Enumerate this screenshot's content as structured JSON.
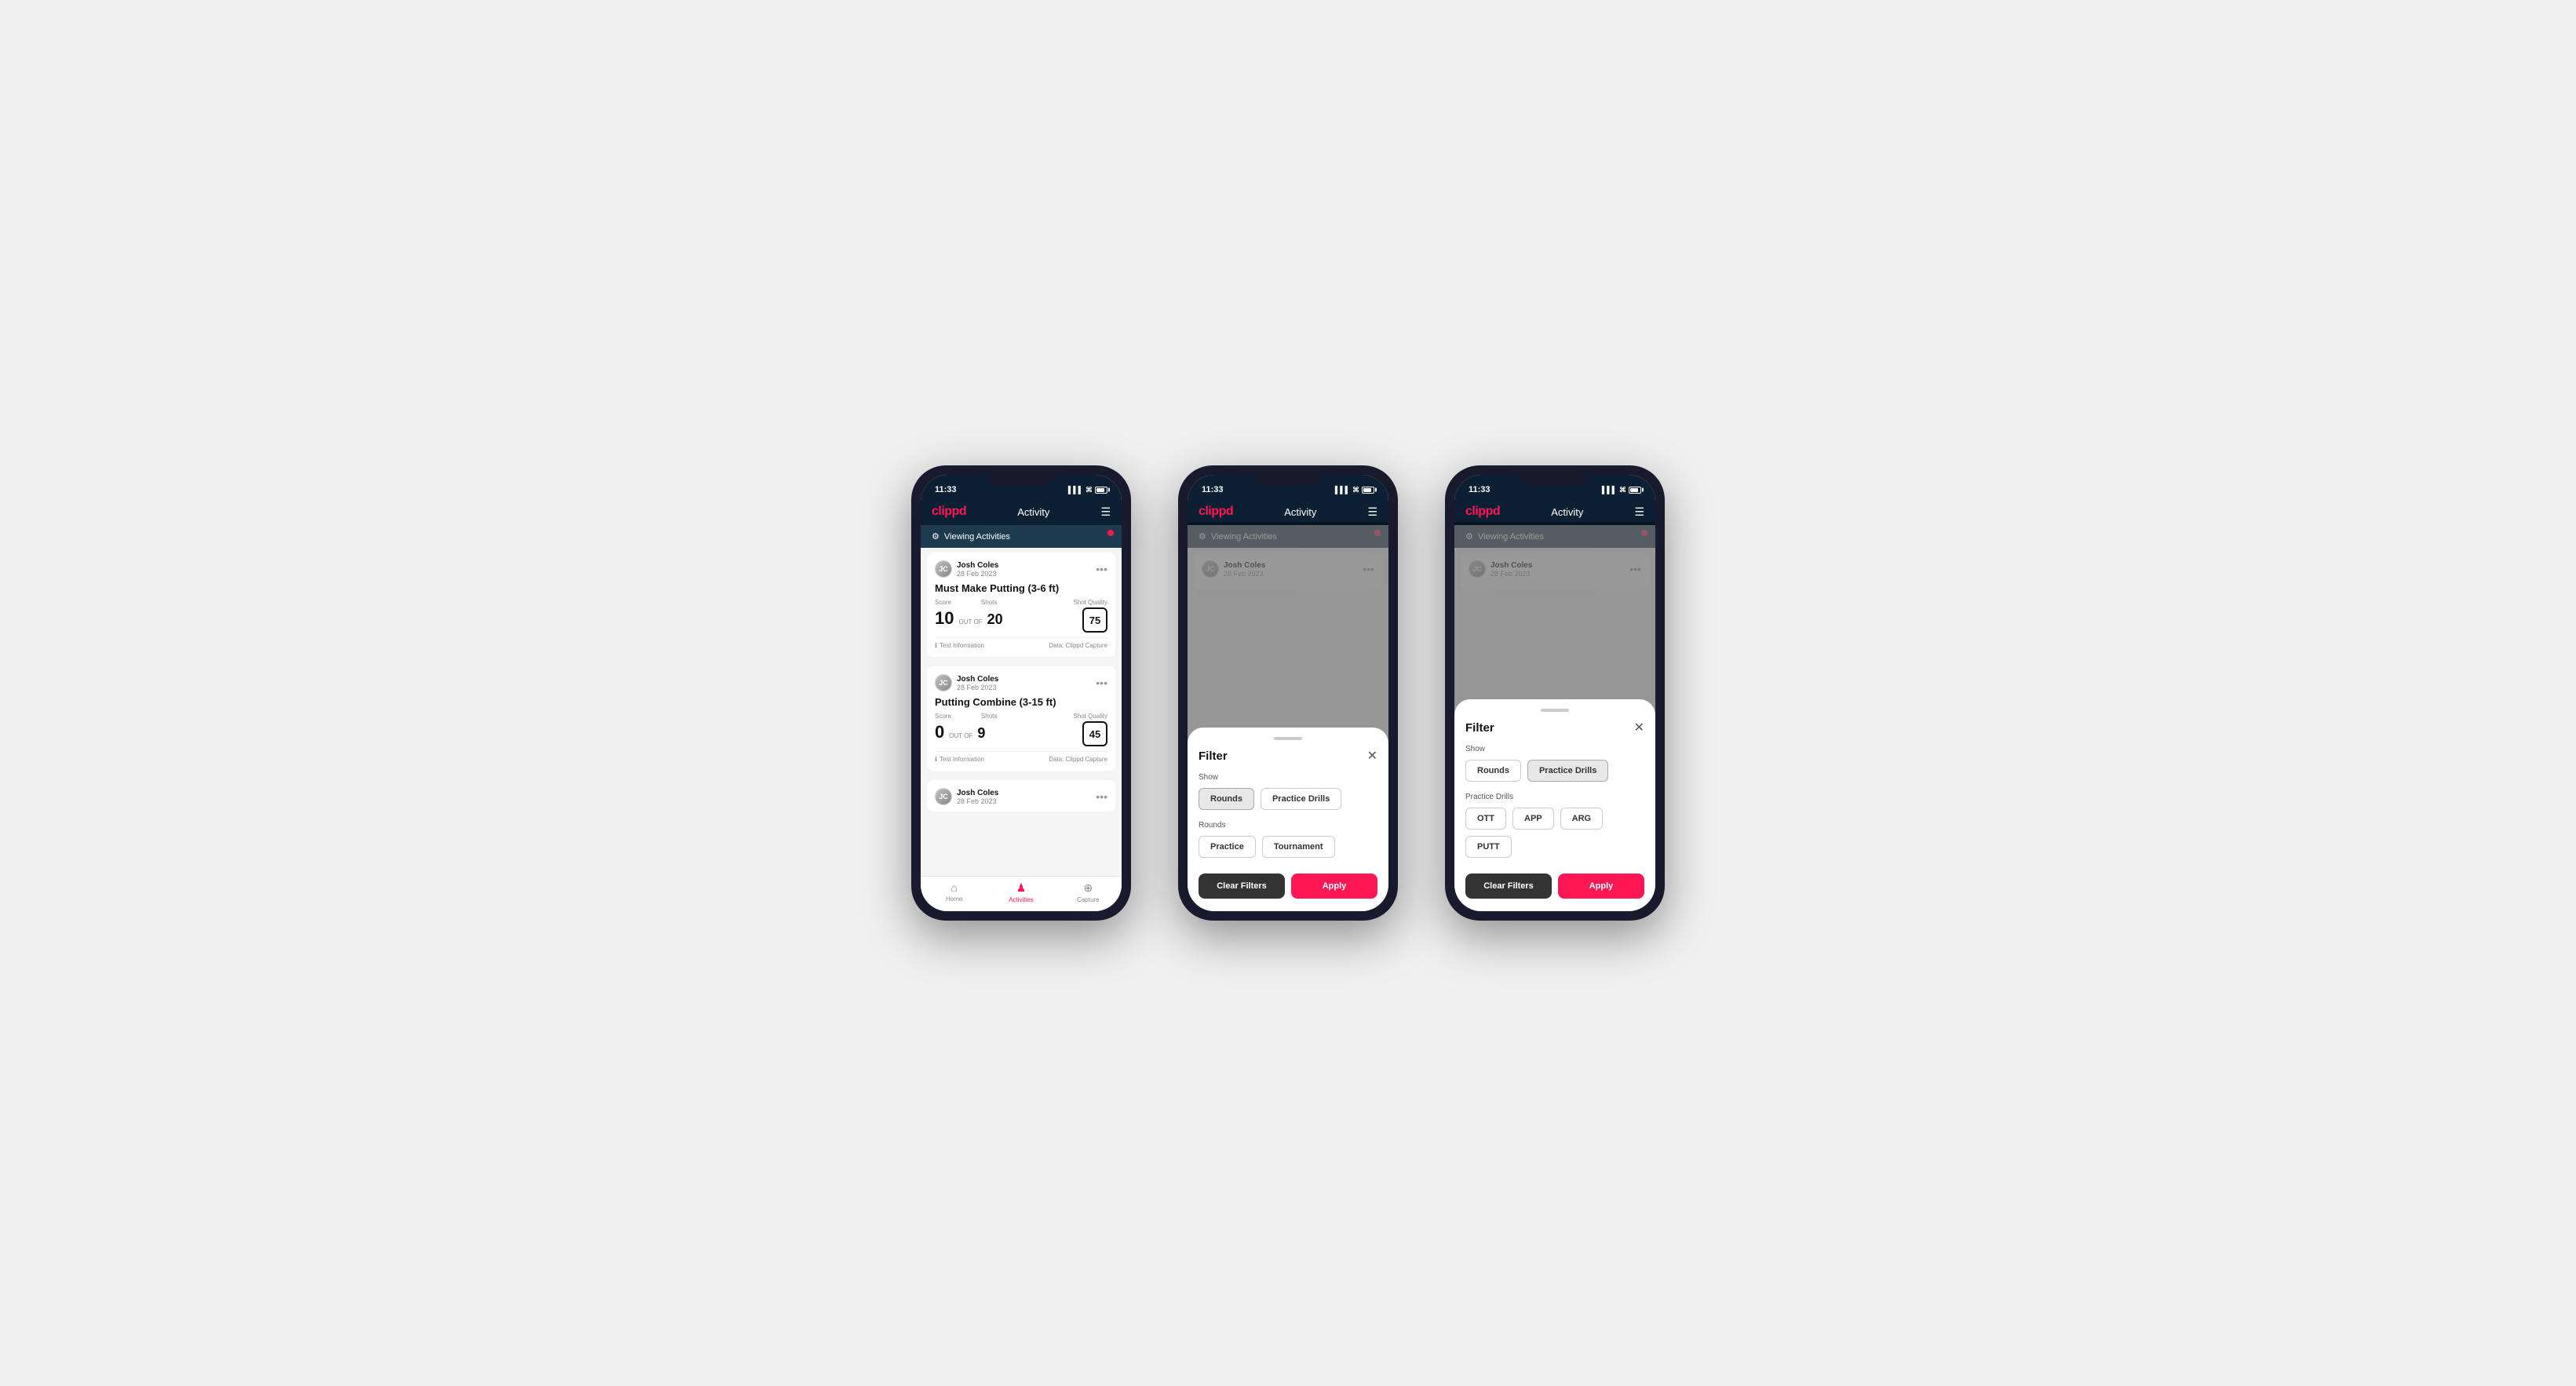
{
  "app": {
    "logo": "clippd",
    "header_title": "Activity",
    "time": "11:33",
    "viewing_bar_text": "Viewing Activities"
  },
  "screen1": {
    "activities": [
      {
        "user_name": "Josh Coles",
        "user_date": "28 Feb 2023",
        "title": "Must Make Putting (3-6 ft)",
        "score_label": "Score",
        "score_value": "10",
        "out_of_label": "OUT OF",
        "shots_label": "Shots",
        "shots_value": "20",
        "shot_quality_label": "Shot Quality",
        "shot_quality_value": "75",
        "footer_info": "Test Information",
        "footer_data": "Data: Clippd Capture"
      },
      {
        "user_name": "Josh Coles",
        "user_date": "28 Feb 2023",
        "title": "Putting Combine (3-15 ft)",
        "score_label": "Score",
        "score_value": "0",
        "out_of_label": "OUT OF",
        "shots_label": "Shots",
        "shots_value": "9",
        "shot_quality_label": "Shot Quality",
        "shot_quality_value": "45",
        "footer_info": "Test Information",
        "footer_data": "Data: Clippd Capture"
      },
      {
        "user_name": "Josh Coles",
        "user_date": "28 Feb 2023",
        "title": "",
        "score_label": "",
        "score_value": "",
        "out_of_label": "",
        "shots_label": "",
        "shots_value": "",
        "shot_quality_label": "",
        "shot_quality_value": "",
        "footer_info": "",
        "footer_data": ""
      }
    ],
    "nav": {
      "home_label": "Home",
      "activities_label": "Activities",
      "capture_label": "Capture"
    }
  },
  "screen2": {
    "filter_title": "Filter",
    "show_label": "Show",
    "rounds_btn": "Rounds",
    "practice_drills_btn": "Practice Drills",
    "rounds_section_label": "Rounds",
    "practice_btn": "Practice",
    "tournament_btn": "Tournament",
    "clear_filters_btn": "Clear Filters",
    "apply_btn": "Apply",
    "rounds_selected": true,
    "practice_drills_selected": false
  },
  "screen3": {
    "filter_title": "Filter",
    "show_label": "Show",
    "rounds_btn": "Rounds",
    "practice_drills_btn": "Practice Drills",
    "practice_drills_section_label": "Practice Drills",
    "ott_btn": "OTT",
    "app_btn": "APP",
    "arg_btn": "ARG",
    "putt_btn": "PUTT",
    "clear_filters_btn": "Clear Filters",
    "apply_btn": "Apply",
    "rounds_selected": false,
    "practice_drills_selected": true
  }
}
